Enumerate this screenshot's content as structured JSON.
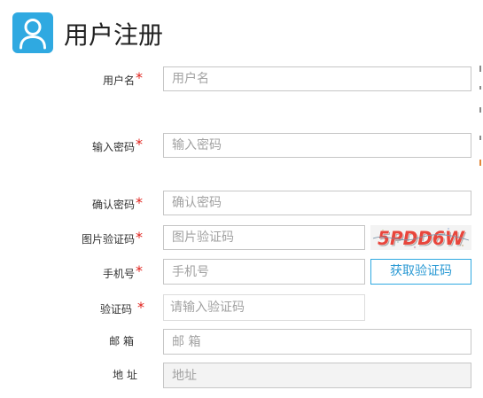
{
  "header": {
    "icon": "user-icon",
    "title": "用户注册"
  },
  "form": {
    "required_mark": "*",
    "username": {
      "label": "用户名",
      "placeholder": "用户名",
      "required": true
    },
    "password": {
      "label": "输入密码",
      "placeholder": "输入密码",
      "required": true
    },
    "confirm_password": {
      "label": "确认密码",
      "placeholder": "确认密码",
      "required": true
    },
    "image_captcha": {
      "label": "图片验证码",
      "placeholder": "图片验证码",
      "required": true,
      "captcha_text": "5PDD6W"
    },
    "phone": {
      "label": "手机号",
      "placeholder": "手机号",
      "required": true,
      "send_code_button": "获取验证码"
    },
    "sms_code": {
      "label": "验证码",
      "placeholder": "请输入验证码",
      "required": true
    },
    "email": {
      "label": "邮 箱",
      "placeholder": "邮 箱",
      "required": false
    },
    "address": {
      "label": "地 址",
      "placeholder": "地址",
      "required": false
    }
  },
  "colors": {
    "brand": "#2fa9e1",
    "required_mark": "#e0201a",
    "button_text": "#2b9ad4",
    "captcha_text": "#e8463c"
  }
}
